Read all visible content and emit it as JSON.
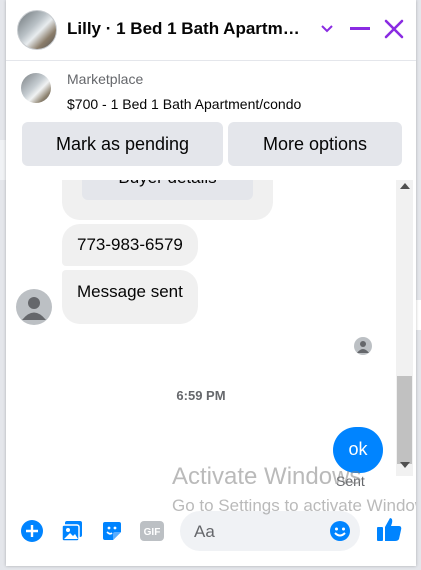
{
  "header": {
    "title": "Lilly · 1 Bed 1 Bath Apartm…"
  },
  "listing": {
    "source": "Marketplace",
    "title": "$700 - 1 Bed 1 Bath Apartment/condo",
    "mark_pending_label": "Mark as pending",
    "more_options_label": "More options"
  },
  "messages": {
    "buyer_details_label": "Buyer details",
    "phone": "773-983-6579",
    "sent_text": "Message sent",
    "timestamp": "6:59 PM",
    "outgoing": "ok",
    "status": "Sent"
  },
  "composer": {
    "placeholder": "Aa"
  },
  "watermark": {
    "line1": "Activate Windows",
    "line2": "Go to Settings to activate Windows."
  },
  "colors": {
    "accent": "#8a2be2",
    "messenger_blue": "#0084ff",
    "bubble_gray": "#f0f0f0"
  },
  "icons": [
    "chevron-down-icon",
    "minimize-icon",
    "close-icon",
    "add-icon",
    "photo-icon",
    "sticker-icon",
    "gif-icon",
    "emoji-icon",
    "like-icon"
  ]
}
